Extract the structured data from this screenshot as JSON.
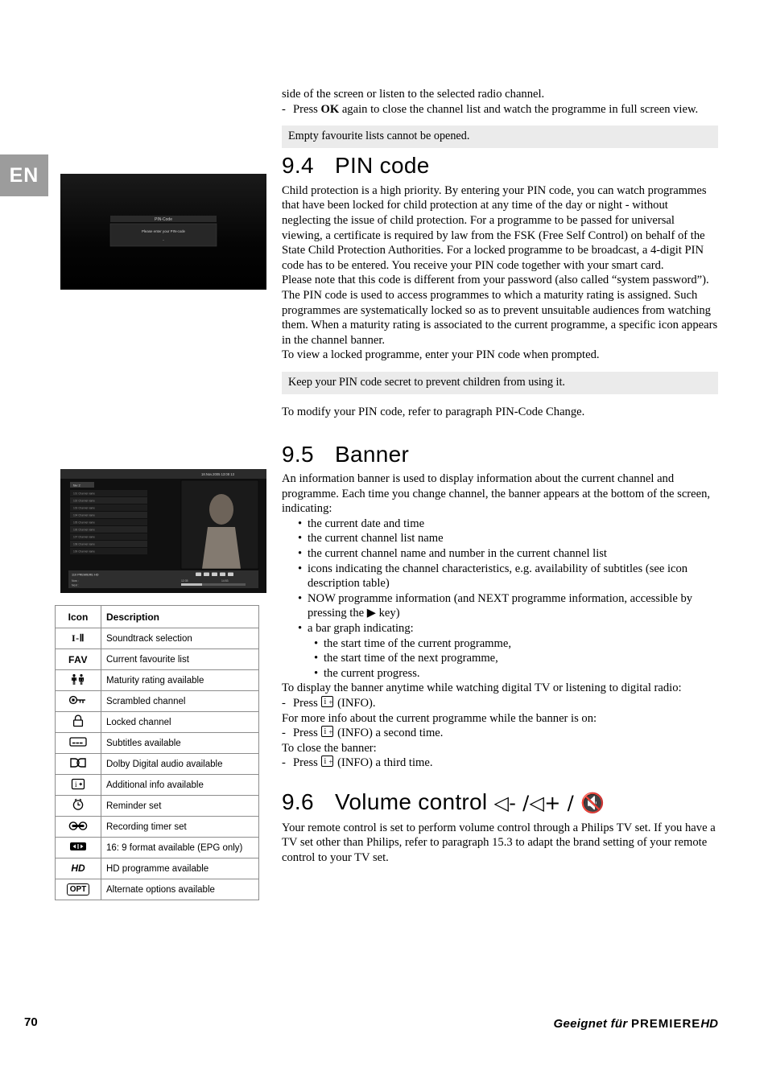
{
  "lang_tab": "EN",
  "top_text": {
    "line1": "side of the screen or listen to the selected radio channel.",
    "dash": "-",
    "line2_pre": "Press ",
    "line2_bold": "OK",
    "line2_post": " again to close the channel list and watch the programme in full screen view."
  },
  "note1": "Empty favourite lists cannot be opened.",
  "sections": {
    "pin": {
      "number": "9.4",
      "title": "PIN code",
      "paragraphs": [
        "Child protection is a high priority. By entering your PIN code, you can watch programmes that have been locked for child protection at any time of the day or night - without neglecting the issue of child protection. For a programme to be passed for universal viewing, a certificate is required by law from the FSK (Free Self Control) on behalf of the State Child Protection Authorities. For a locked programme to be broadcast, a 4-digit PIN code has to be entered. You receive your PIN code together with your smart card.",
        "Please note that this code is different from your password (also called “system password”). The PIN code is used to access programmes to which a maturity rating is assigned. Such programmes are systematically locked so as to prevent unsuitable audiences from watching them. When a maturity rating is associated to the current programme, a specific icon appears in the channel banner.",
        "To view a locked programme, enter your PIN code when prompted."
      ],
      "note": "Keep your PIN code secret to prevent children from using it.",
      "closing": "To modify your PIN code, refer to paragraph PIN-Code Change."
    },
    "banner": {
      "number": "9.5",
      "title": "Banner",
      "intro": "An information banner is used to display information about the current channel and programme. Each time you change channel, the banner appears at the bottom of the screen, indicating:",
      "bullets": [
        "the current date and time",
        "the current channel list name",
        "the current channel name and number in the current channel list",
        "icons indicating the channel characteristics, e.g. availability of subtitles (see icon description table)",
        "NOW programme information (and NEXT programme information, accessible by pressing the ▶ key)",
        "a bar graph indicating:"
      ],
      "subbullets": [
        "the start time of the current programme,",
        "the start time of the next programme,",
        "the current progress."
      ],
      "display_line": "To display the banner anytime while watching digital TV or listening to digital radio:",
      "press1": "Press",
      "press1_suffix": "(INFO).",
      "moreinfo_line": "For more info about the current programme while the banner is on:",
      "press2": "Press",
      "press2_suffix": "(INFO) a second time.",
      "close_line": "To close the banner:",
      "press3": "Press",
      "press3_suffix": "(INFO) a third time."
    },
    "volume": {
      "number": "9.6",
      "title": "Volume control",
      "title_symbols": "◁- /◁+ /",
      "paragraph": "Your remote control is set to perform volume control through a Philips TV set. If you have a TV set other than Philips, refer to paragraph 15.3 to adapt the brand setting of your remote control to your TV set."
    }
  },
  "icon_table": {
    "headers": [
      "Icon",
      "Description"
    ],
    "rows": [
      {
        "icon": "I-II",
        "icon_style": "plain",
        "desc": "Soundtrack selection"
      },
      {
        "icon": "FAV",
        "icon_style": "plain",
        "desc": "Current favourite list"
      },
      {
        "icon": "maturity-rating-icon",
        "icon_style": "svg",
        "desc": "Maturity rating available"
      },
      {
        "icon": "scrambled-key-icon",
        "icon_style": "svg",
        "desc": "Scrambled channel"
      },
      {
        "icon": "padlock-icon",
        "icon_style": "svg",
        "desc": "Locked channel"
      },
      {
        "icon": "subtitles-icon",
        "icon_style": "svg",
        "desc": "Subtitles available"
      },
      {
        "icon": "dolby-digital-icon",
        "icon_style": "svg",
        "desc": "Dolby Digital audio available"
      },
      {
        "icon": "info-plus-icon",
        "icon_style": "svg",
        "desc": "Additional info available"
      },
      {
        "icon": "reminder-clock-icon",
        "icon_style": "svg",
        "desc": "Reminder set"
      },
      {
        "icon": "recording-timer-icon",
        "icon_style": "svg",
        "desc": "Recording timer set"
      },
      {
        "icon": "widescreen-icon",
        "icon_style": "svg",
        "desc": "16: 9 format available (EPG only)"
      },
      {
        "icon": "HD",
        "icon_style": "box",
        "desc": "HD programme available"
      },
      {
        "icon": "OPT",
        "icon_style": "box",
        "desc": "Alternate options available"
      }
    ]
  },
  "screenshots": {
    "pin": {
      "name": "pin-code-screen",
      "title": "PIN-Code",
      "prompt": "Please enter your PIN-code",
      "field": "-"
    },
    "banner": {
      "name": "banner-screen",
      "clock": "18.Nov.2005   13:08      13",
      "list_label": "fav 2",
      "channel_number": "110",
      "channel_name": "PREMIERE HD",
      "now_label": "Now :",
      "next_label": "Next :",
      "time_left": "12:35",
      "time_right": "14:53"
    }
  },
  "footer": {
    "page_number": "70",
    "brand_prefix": "Geeignet für ",
    "brand_name": "PREMIERE",
    "brand_hd": "HD"
  }
}
